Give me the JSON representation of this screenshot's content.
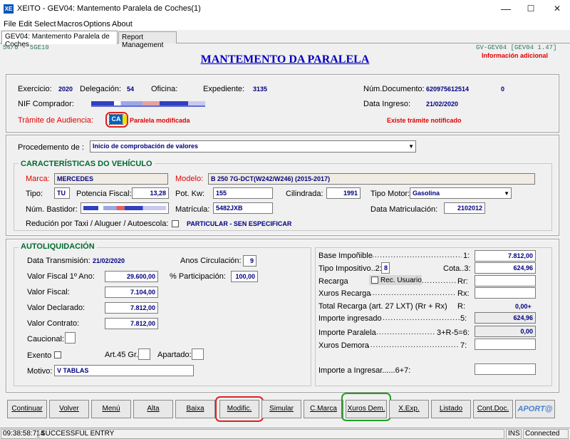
{
  "window": {
    "app_icon": "XE",
    "title": "XEITO - GEV04: Mantemento Paralela de Coches(1)",
    "min": "—",
    "max": "☐",
    "close": "✕"
  },
  "menu": [
    "File",
    "Edit",
    "Select",
    "Macros",
    "Options",
    "About"
  ],
  "tabs": [
    "GEV04: Mantemento Paralela de Coches",
    "Report Management"
  ],
  "header": {
    "left_code": "54/0 - 5GE10",
    "right_code": "GV-GEV04 [GEV04 1.47]",
    "info": "Información adicional",
    "title": "MANTEMENTO DA PARALELA"
  },
  "top": {
    "exercicio_label": "Exercicio:",
    "exercicio": "2020",
    "delegacion_label": "Delegación:",
    "delegacion": "54",
    "oficina_label": "Oficina:",
    "expediente_label": "Expediente:",
    "expediente": "3135",
    "numdoc_label": "Núm.Documento:",
    "numdoc": "620975612514",
    "numdoc_suffix": "0",
    "nif_label": "NIF Comprador:",
    "data_ingreso_label": "Data Ingreso:",
    "data_ingreso": "21/02/2020",
    "tramite_label": "Trámite de Audiencia:",
    "tramite_code": "CA",
    "paralela_mod": "Paralela modificada",
    "tramite_notif": "Existe trámite notificado"
  },
  "procedimento": {
    "label": "Procedemento de :",
    "value": "Inicio de comprobación de valores"
  },
  "vehiculo": {
    "title": "CARACTERÍSTICAS DO VEHÍCULO",
    "marca_label": "Marca:",
    "marca": "MERCEDES",
    "modelo_label": "Modelo:",
    "modelo": "B 250 7G-DCT(W242/W246) (2015-2017)",
    "tipo_label": "Tipo:",
    "tipo": "TU",
    "potencia_label": "Potencia Fiscal:",
    "potencia": "13,28",
    "potkw_label": "Pot. Kw:",
    "potkw": "155",
    "cilindrada_label": "Cilindrada:",
    "cilindrada": "1991",
    "tipomotor_label": "Tipo Motor:",
    "tipomotor": "Gasolina",
    "bastidor_label": "Núm. Bastidor:",
    "matricula_label": "Matrícula:",
    "matricula": "5482JXB",
    "datamat_label": "Data Matriculación:",
    "datamat": "2102012",
    "reducion_label": "Redución por Taxi / Aluguer / Autoescola:",
    "reducion_value": "PARTICULAR - SEN ESPECIFICAR"
  },
  "auto": {
    "title": "AUTOLIQUIDACIÓN",
    "data_trans_label": "Data Transmisión:",
    "data_trans": "21/02/2020",
    "anos_label": "Anos Circulación:",
    "anos": "9",
    "vf1_label": "Valor Fiscal 1º Ano:",
    "vf1": "29.600,00",
    "part_label": "% Participación:",
    "part": "100,00",
    "vf_label": "Valor Fiscal:",
    "vf": "7.104,00",
    "vd_label": "Valor Declarado:",
    "vd": "7.812,00",
    "vc_label": "Valor Contrato:",
    "vc": "7.812,00",
    "caucional_label": "Caucional:",
    "exento_label": "Exento",
    "art45_label": "Art.45 Gr.:",
    "apartado_label": "Apartado:",
    "motivo_label": "Motivo:",
    "motivo": "V TABLAS"
  },
  "liq": {
    "base_label": "Base Impoñible",
    "base_ref": "1:",
    "base": "7.812,00",
    "tipo_label": "Tipo Impositivo..2:",
    "tipo": "8",
    "cota_label": "Cota..3:",
    "cota": "624,96",
    "recarga_label": "Recarga",
    "rec_usuario": "Rec. Usuario",
    "recarga_ref": "Rr:",
    "xurosrec_label": "Xuros Recarga",
    "xurosrec_ref": "Rx:",
    "total_label": "Total Recarga (art. 27 LXT)   (Rr + Rx)",
    "total_ref": "R:",
    "total": "0,00+",
    "importe_ing_label": "Importe ingresado",
    "importe_ing_ref": "5:",
    "importe_ing": "624,96",
    "importe_par_label": "Importe Paralela",
    "importe_par_ref": "3+R-5=6:",
    "importe_par": "0,00",
    "xurosdem_label": "Xuros Demora",
    "xurosdem_ref": "7:",
    "importe_ingresar_label": "Importe a Ingresar......6+7:"
  },
  "buttons": [
    "Continuar",
    "Volver",
    "Menú",
    "Alta",
    "Baixa",
    "Modific.",
    "Simular",
    "C.Marca",
    "Xuros Dem.",
    "X.Exp.",
    "Listado",
    "Cont.Doc.",
    "APORT@"
  ],
  "status": {
    "time": "09:38:58:714",
    "message": "SUCCESSFUL ENTRY",
    "ins": "INS",
    "connected": "Connected"
  }
}
